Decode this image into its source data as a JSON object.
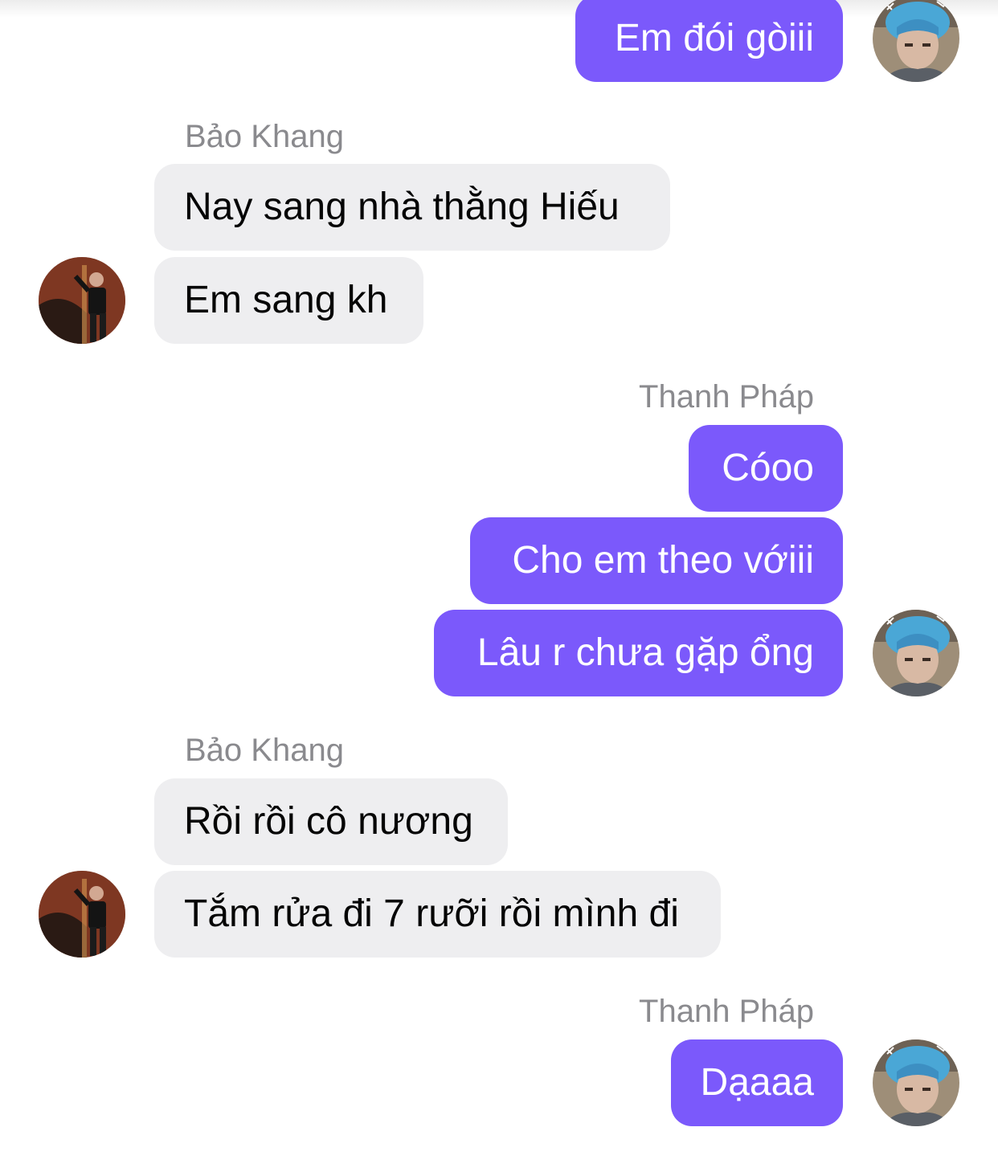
{
  "participants": {
    "left": "Bảo Khang",
    "right": "Thanh Pháp"
  },
  "messages": [
    {
      "text": "Em đói gòiii"
    },
    {
      "sender": "Bảo Khang"
    },
    {
      "text": "Nay sang nhà thằng Hiếu"
    },
    {
      "text": "Em sang kh"
    },
    {
      "sender": "Thanh Pháp"
    },
    {
      "text": "Cóoo"
    },
    {
      "text": "Cho em theo vớiii"
    },
    {
      "text": "Lâu r chưa gặp ổng"
    },
    {
      "sender": "Bảo Khang"
    },
    {
      "text": "Rồi rồi cô nương"
    },
    {
      "text": "Tắm rửa đi 7 rưỡi rồi mình đi"
    },
    {
      "sender": "Thanh Pháp"
    },
    {
      "text": "Dạaaa"
    }
  ],
  "colors": {
    "outgoing_bubble": "#7b59fb",
    "incoming_bubble": "#eeeef0",
    "sender_name": "#8a8a8e"
  },
  "icons": {
    "right_avatar": "avatar-blue-hair-icon",
    "left_avatar": "avatar-dark-photo-icon"
  }
}
